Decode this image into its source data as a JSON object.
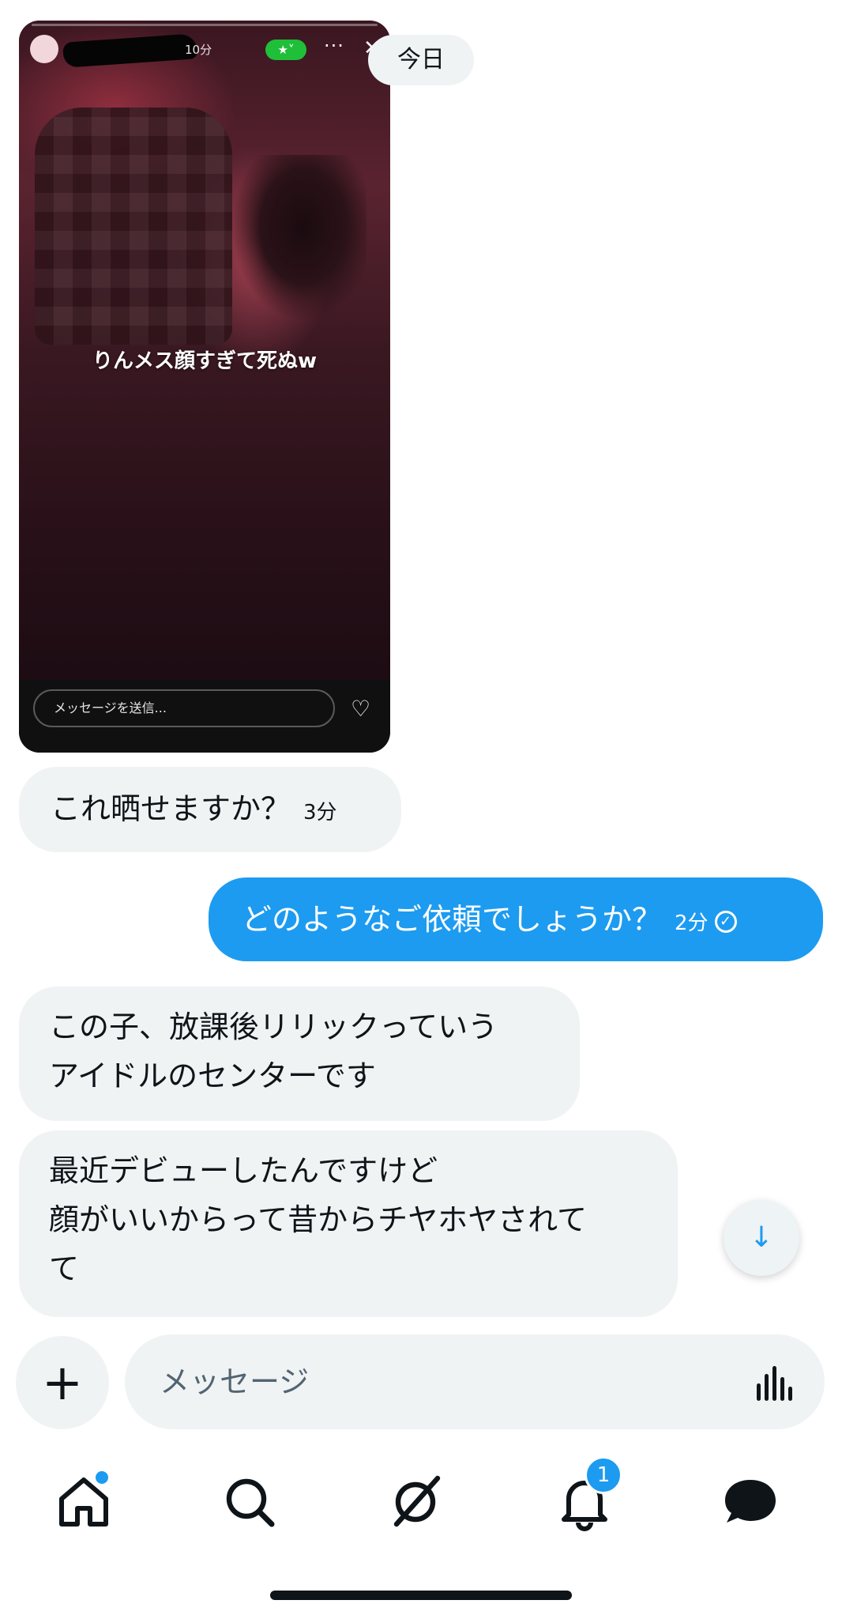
{
  "date_divider": "今日",
  "story": {
    "time": "10分",
    "more": "···",
    "close": "✕",
    "caption": "りんメス顔すぎて死ぬw",
    "reply_placeholder": "メッセージを送信..."
  },
  "messages": [
    {
      "direction": "in",
      "text": "これ晒せますか？",
      "time": "3分"
    },
    {
      "direction": "out",
      "text": "どのようなご依頼でしょうか？",
      "time": "2分"
    },
    {
      "direction": "in",
      "lines": [
        "この子、放課後リリックっていう",
        "アイドルのセンターです"
      ]
    },
    {
      "direction": "in",
      "lines": [
        "最近デビューしたんですけど",
        "顔がいいからって昔からチヤホヤされて",
        "て"
      ]
    }
  ],
  "composer": {
    "placeholder": "メッセージ",
    "plus": "+"
  },
  "scroll_down": "↓",
  "tabbar": {
    "notifications_badge": "1"
  },
  "colors": {
    "accent": "#1d9bf0",
    "bubble_in": "#eff3f4",
    "text": "#0f1419",
    "muted": "#536471"
  }
}
